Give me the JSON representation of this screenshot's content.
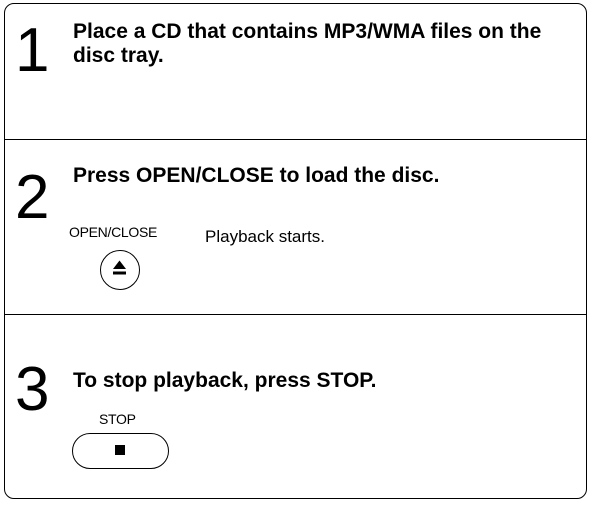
{
  "steps": [
    {
      "number": "1",
      "title": "Place a CD that contains MP3/WMA files on the disc tray."
    },
    {
      "number": "2",
      "title": "Press OPEN/CLOSE to load the disc.",
      "button_label": "OPEN/CLOSE",
      "button_icon": "eject-icon",
      "description": "Playback starts."
    },
    {
      "number": "3",
      "title": "To stop playback, press STOP.",
      "button_label": "STOP",
      "button_icon": "stop-icon"
    }
  ]
}
